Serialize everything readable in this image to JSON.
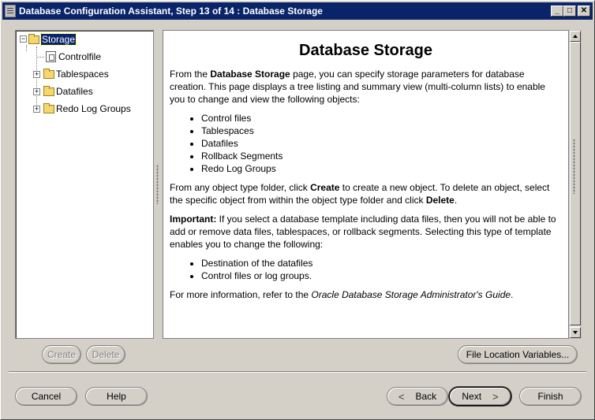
{
  "window": {
    "title": "Database Configuration Assistant, Step 13 of 14 : Database Storage"
  },
  "tree": {
    "root": "Storage",
    "items": [
      "Controlfile",
      "Tablespaces",
      "Datafiles",
      "Redo Log Groups"
    ]
  },
  "content": {
    "heading": "Database Storage",
    "p1_a": "From the ",
    "p1_b": "Database Storage",
    "p1_c": " page, you can specify storage parameters for database creation. This page displays a tree listing and summary view (multi-column lists) to enable you to change and view the following objects:",
    "list1": [
      "Control files",
      "Tablespaces",
      "Datafiles",
      "Rollback Segments",
      "Redo Log Groups"
    ],
    "p2_a": "From any object type folder, click ",
    "p2_b": "Create",
    "p2_c": " to create a new object. To delete an object, select the specific object from within the object type folder and click ",
    "p2_d": "Delete",
    "p2_e": ".",
    "p3_a": "Important:",
    "p3_b": " If you select a database template including data files, then you will not be able to add or remove data files, tablespaces, or rollback segments. Selecting this type of template enables you to change the following:",
    "list2": [
      "Destination of the datafiles",
      "Control files or log groups."
    ],
    "p4_a": "For more information, refer to the ",
    "p4_b": "Oracle Database Storage Administrator's Guide",
    "p4_c": "."
  },
  "buttons": {
    "create": "Create",
    "delete": "Delete",
    "file_location": "File Location Variables...",
    "cancel": "Cancel",
    "help": "Help",
    "back": "Back",
    "next": "Next",
    "finish": "Finish"
  }
}
